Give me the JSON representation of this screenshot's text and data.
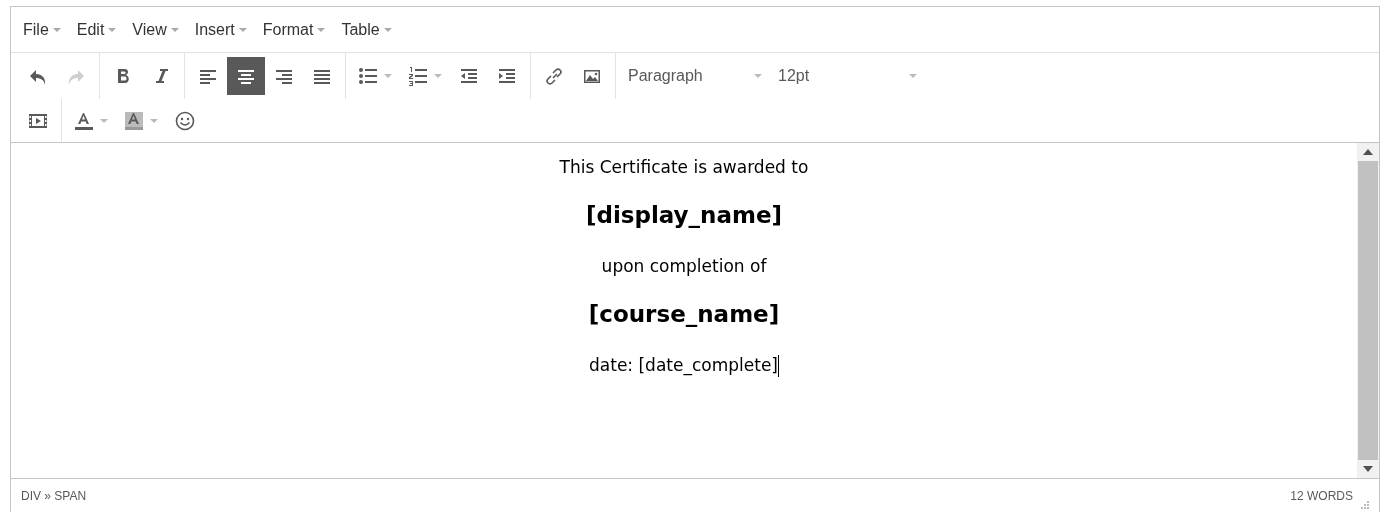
{
  "menu_bar": [
    {
      "label": "File"
    },
    {
      "label": "Edit"
    },
    {
      "label": "View"
    },
    {
      "label": "Insert"
    },
    {
      "label": "Format"
    },
    {
      "label": "Table"
    }
  ],
  "toolbar_rows": [
    [
      {
        "buttons": [
          {
            "kind": "undo",
            "disabled": false,
            "selected": false
          },
          {
            "kind": "redo",
            "disabled": true,
            "selected": false
          }
        ]
      },
      {
        "buttons": [
          {
            "kind": "bold",
            "disabled": false,
            "selected": false
          },
          {
            "kind": "italic",
            "disabled": false,
            "selected": false
          }
        ]
      },
      {
        "buttons": [
          {
            "kind": "align-left",
            "disabled": false,
            "selected": false
          },
          {
            "kind": "align-center",
            "disabled": false,
            "selected": true
          },
          {
            "kind": "align-right",
            "disabled": false,
            "selected": false
          },
          {
            "kind": "align-justify",
            "disabled": false,
            "selected": false
          }
        ]
      },
      {
        "buttons": [
          {
            "kind": "bullet-list",
            "disabled": false,
            "selected": false,
            "split": true
          },
          {
            "kind": "numbered-list",
            "disabled": false,
            "selected": false,
            "split": true
          },
          {
            "kind": "outdent",
            "disabled": false,
            "selected": false
          },
          {
            "kind": "indent",
            "disabled": false,
            "selected": false
          }
        ]
      },
      {
        "buttons": [
          {
            "kind": "link",
            "disabled": false,
            "selected": false
          },
          {
            "kind": "image",
            "disabled": false,
            "selected": false
          }
        ]
      },
      {
        "selects": [
          {
            "value": "Paragraph"
          },
          {
            "value": "12pt"
          }
        ]
      }
    ],
    [
      {
        "buttons": [
          {
            "kind": "media",
            "disabled": false,
            "selected": false
          }
        ]
      },
      {
        "buttons": [
          {
            "kind": "text-color",
            "disabled": false,
            "selected": false,
            "split": true
          },
          {
            "kind": "background-color",
            "disabled": false,
            "selected": false,
            "split": true
          },
          {
            "kind": "emoticons",
            "disabled": false,
            "selected": false
          }
        ]
      }
    ]
  ],
  "content": [
    {
      "kind": "text",
      "text": "This Certificate is awarded to"
    },
    {
      "kind": "heading",
      "text": "[display_name]"
    },
    {
      "kind": "text",
      "text": "upon completion of"
    },
    {
      "kind": "heading",
      "text": "[course_name]"
    },
    {
      "kind": "text",
      "text": "date: [date_complete]",
      "cursor": true
    }
  ],
  "status_bar": {
    "path": "DIV » SPAN",
    "word_count": "12 WORDS"
  }
}
